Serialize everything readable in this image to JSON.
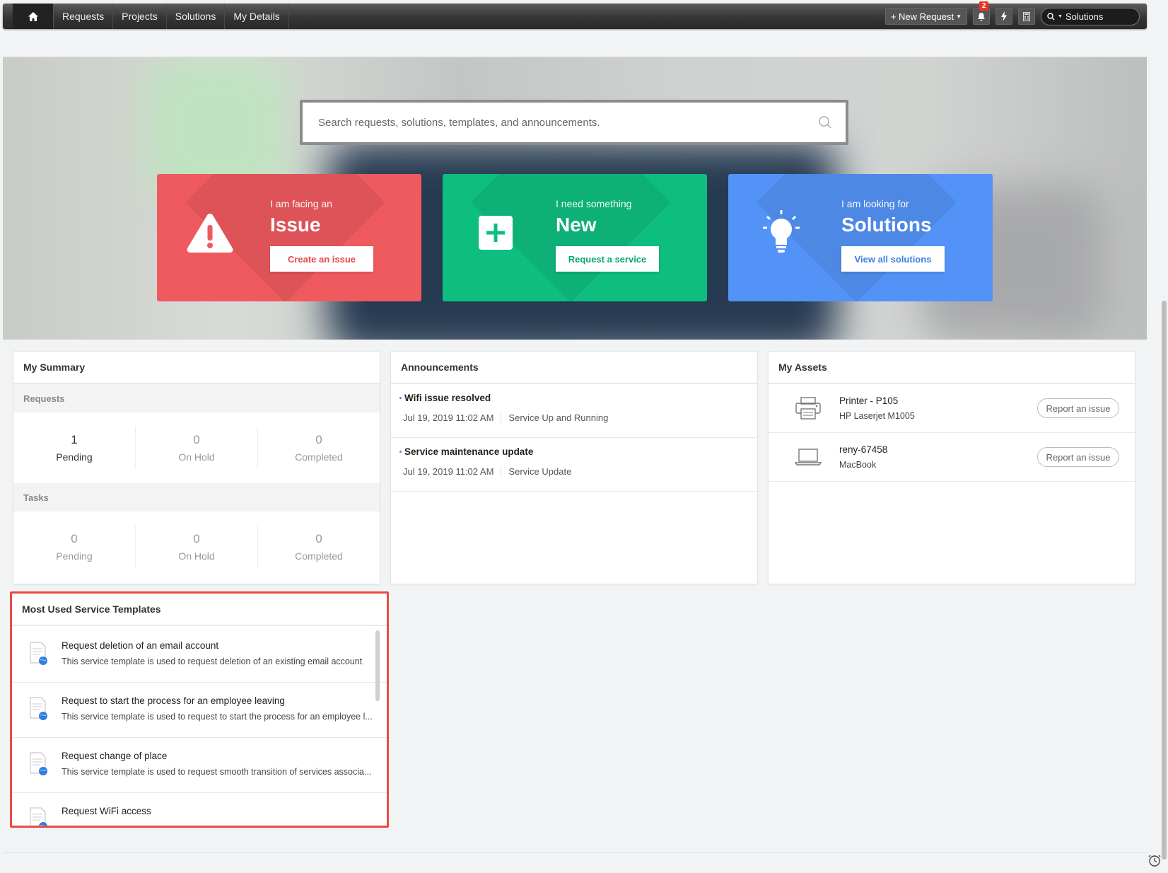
{
  "navbar": {
    "items": [
      "Requests",
      "Projects",
      "Solutions",
      "My Details"
    ],
    "new_request_label": "+ New Request",
    "notification_count": "2",
    "search_scope": "Solutions"
  },
  "hero": {
    "search_placeholder": "Search requests, solutions, templates, and announcements.",
    "cards": [
      {
        "sub": "I am facing an",
        "title": "Issue",
        "button": "Create an issue",
        "color": "#ef5a5f"
      },
      {
        "sub": "I need something",
        "title": "New",
        "button": "Request a service",
        "color": "#0ebe7f"
      },
      {
        "sub": "I am looking for",
        "title": "Solutions",
        "button": "View all solutions",
        "color": "#5393f7"
      }
    ]
  },
  "summary": {
    "title": "My Summary",
    "requests_label": "Requests",
    "tasks_label": "Tasks",
    "requests": [
      {
        "count": "1",
        "label": "Pending"
      },
      {
        "count": "0",
        "label": "On Hold"
      },
      {
        "count": "0",
        "label": "Completed"
      }
    ],
    "tasks": [
      {
        "count": "0",
        "label": "Pending"
      },
      {
        "count": "0",
        "label": "On Hold"
      },
      {
        "count": "0",
        "label": "Completed"
      }
    ]
  },
  "announcements": {
    "title": "Announcements",
    "items": [
      {
        "title": "Wifi issue resolved",
        "date": "Jul 19, 2019 11:02 AM",
        "category": "Service Up and Running"
      },
      {
        "title": "Service maintenance update",
        "date": "Jul 19, 2019 11:02 AM",
        "category": "Service Update"
      }
    ]
  },
  "assets": {
    "title": "My Assets",
    "report_label": "Report an issue",
    "items": [
      {
        "name": "Printer - P105",
        "model": "HP Laserjet M1005",
        "icon": "printer-icon"
      },
      {
        "name": "reny-67458",
        "model": "MacBook",
        "icon": "laptop-icon"
      }
    ]
  },
  "templates": {
    "title": "Most Used Service Templates",
    "items": [
      {
        "title": "Request deletion of an email account",
        "desc": "This service template is used to request deletion of an existing email account"
      },
      {
        "title": "Request to start the process for an employee leaving",
        "desc": "This service template is used to request to start the process for an employee l..."
      },
      {
        "title": "Request change of place",
        "desc": "This service template is used to request smooth transition of services associa..."
      },
      {
        "title": "Request WiFi access",
        "desc": ""
      }
    ]
  },
  "colors": {
    "highlight": "#e94b43",
    "accent_blue": "#3a8ee6"
  }
}
